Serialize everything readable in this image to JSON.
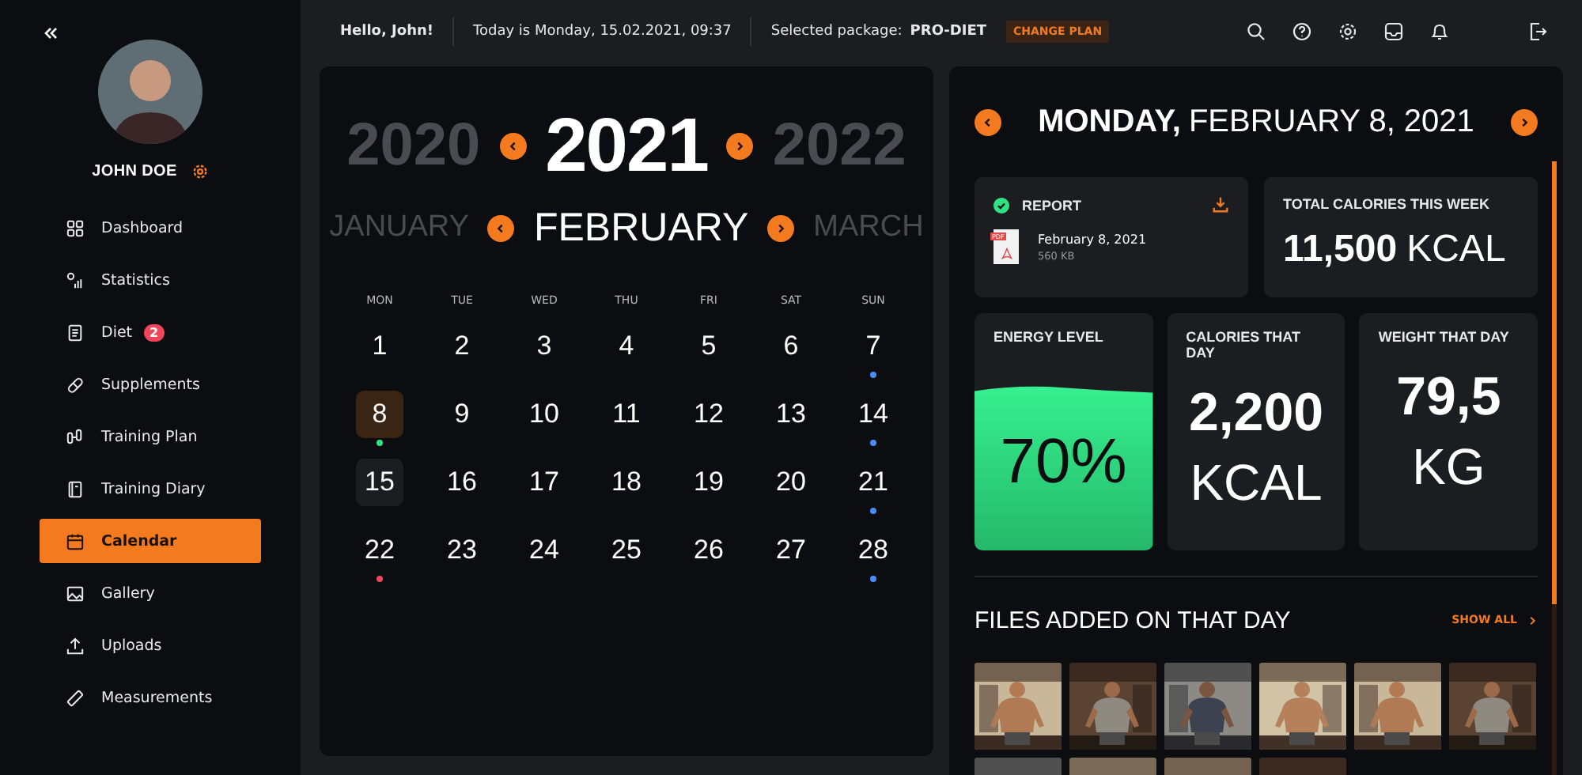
{
  "sidebar": {
    "user_name": "JOHN DOE",
    "items": [
      {
        "label": "Dashboard",
        "selected": false
      },
      {
        "label": "Statistics",
        "selected": false
      },
      {
        "label": "Diet",
        "selected": false,
        "badge": "2"
      },
      {
        "label": "Supplements",
        "selected": false
      },
      {
        "label": "Training Plan",
        "selected": false
      },
      {
        "label": "Training Diary",
        "selected": false
      },
      {
        "label": "Calendar",
        "selected": true
      },
      {
        "label": "Gallery",
        "selected": false
      },
      {
        "label": "Uploads",
        "selected": false
      },
      {
        "label": "Measurements",
        "selected": false
      }
    ]
  },
  "header": {
    "greeting": "Hello, John!",
    "today": "Today is Monday, 15.02.2021, 09:37",
    "package_label": "Selected package:",
    "package": "PRO-DIET",
    "change_plan": "CHANGE PLAN"
  },
  "calendar": {
    "year": "2021",
    "prev_year": "2020",
    "next_year": "2022",
    "month": "FEBRUARY",
    "prev_month": "JANUARY",
    "next_month": "MARCH",
    "weekdays": [
      "MON",
      "TUE",
      "WED",
      "THU",
      "FRI",
      "SAT",
      "SUN"
    ],
    "days": [
      {
        "label": "1",
        "selected": false,
        "today": false
      },
      {
        "label": "2",
        "selected": false,
        "today": false
      },
      {
        "label": "3",
        "selected": false,
        "today": false
      },
      {
        "label": "4",
        "selected": false,
        "today": false
      },
      {
        "label": "5",
        "selected": false,
        "today": false
      },
      {
        "label": "6",
        "selected": false,
        "today": false
      },
      {
        "label": "7",
        "selected": false,
        "today": false,
        "color": "#4a8cf7"
      },
      {
        "label": "8",
        "selected": true,
        "today": false,
        "color": "#2ee383"
      },
      {
        "label": "9",
        "selected": false,
        "today": false
      },
      {
        "label": "10",
        "selected": false,
        "today": false
      },
      {
        "label": "11",
        "selected": false,
        "today": false
      },
      {
        "label": "12",
        "selected": false,
        "today": false
      },
      {
        "label": "13",
        "selected": false,
        "today": false
      },
      {
        "label": "14",
        "selected": false,
        "today": false,
        "color": "#4a8cf7"
      },
      {
        "label": "15",
        "selected": false,
        "today": true
      },
      {
        "label": "16",
        "selected": false,
        "today": false
      },
      {
        "label": "17",
        "selected": false,
        "today": false
      },
      {
        "label": "18",
        "selected": false,
        "today": false
      },
      {
        "label": "19",
        "selected": false,
        "today": false
      },
      {
        "label": "20",
        "selected": false,
        "today": false
      },
      {
        "label": "21",
        "selected": false,
        "today": false,
        "color": "#4a8cf7"
      },
      {
        "label": "22",
        "selected": false,
        "today": false,
        "color": "#f0455a"
      },
      {
        "label": "23",
        "selected": false,
        "today": false
      },
      {
        "label": "24",
        "selected": false,
        "today": false
      },
      {
        "label": "25",
        "selected": false,
        "today": false
      },
      {
        "label": "26",
        "selected": false,
        "today": false
      },
      {
        "label": "27",
        "selected": false,
        "today": false
      },
      {
        "label": "28",
        "selected": false,
        "today": false,
        "color": "#4a8cf7"
      }
    ]
  },
  "day": {
    "weekday": "MONDAY,",
    "date": "FEBRUARY 8, 2021",
    "report": {
      "title": "REPORT",
      "file_type": "PDF",
      "file_name": "February 8, 2021",
      "file_size": "560 KB"
    },
    "week_calories": {
      "title": "TOTAL CALORIES THIS WEEK",
      "value": "11,500",
      "unit": "KCAL"
    },
    "energy": {
      "title": "ENERGY LEVEL",
      "value": "70%",
      "level": 0.7
    },
    "calories": {
      "title": "CALORIES THAT DAY",
      "value": "2,200",
      "unit": "KCAL"
    },
    "weight": {
      "title": "WEIGHT THAT DAY",
      "value": "79,5",
      "unit": "KG"
    },
    "files": {
      "title": "FILES ADDED ON THAT DAY",
      "show_all": "SHOW ALL"
    }
  }
}
